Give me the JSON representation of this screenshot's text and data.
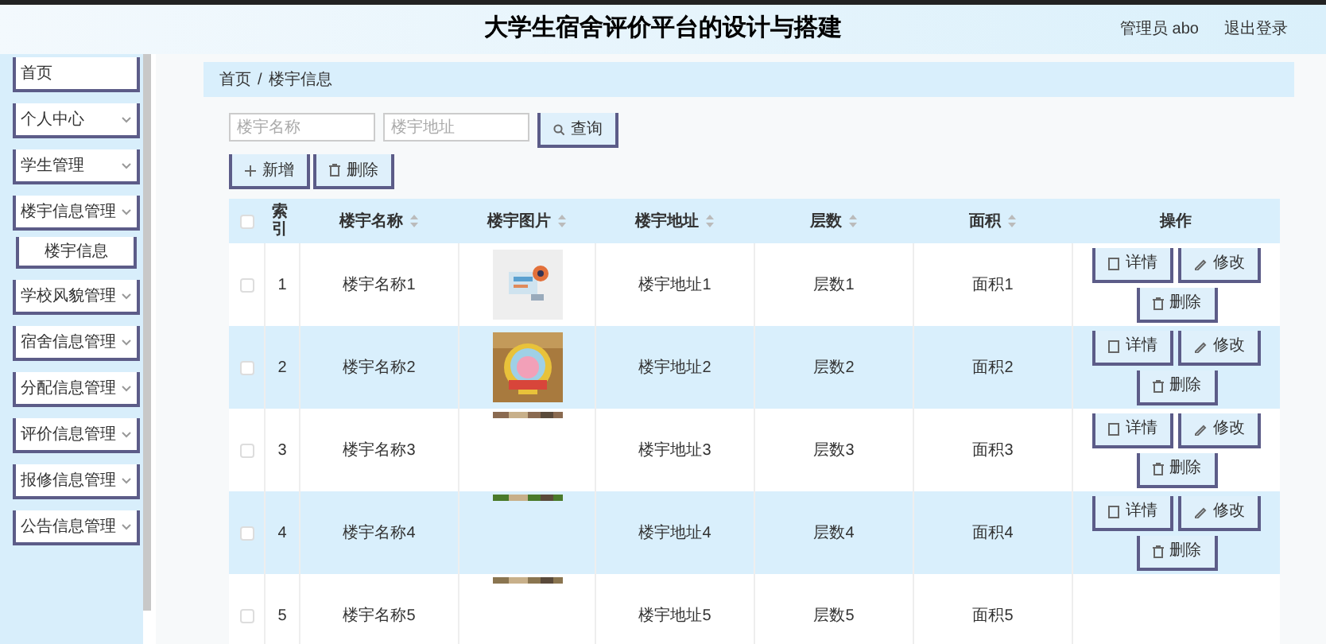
{
  "header": {
    "title": "大学生宿舍评价平台的设计与搭建",
    "user": "管理员 abo",
    "logout": "退出登录"
  },
  "sidebar": {
    "items": [
      {
        "label": "首页",
        "expandable": false
      },
      {
        "label": "个人中心",
        "expandable": true
      },
      {
        "label": "学生管理",
        "expandable": true
      },
      {
        "label": "楼宇信息管理",
        "expandable": true,
        "children": [
          {
            "label": "楼宇信息",
            "expandable": false
          }
        ]
      },
      {
        "label": "学校风貌管理",
        "expandable": true
      },
      {
        "label": "宿舍信息管理",
        "expandable": true
      },
      {
        "label": "分配信息管理",
        "expandable": true
      },
      {
        "label": "评价信息管理",
        "expandable": true
      },
      {
        "label": "报修信息管理",
        "expandable": true
      },
      {
        "label": "公告信息管理",
        "expandable": true
      }
    ]
  },
  "breadcrumb": [
    "首页",
    "/",
    "楼宇信息"
  ],
  "search": {
    "fields": [
      {
        "placeholder": "楼宇名称"
      },
      {
        "placeholder": "楼宇地址"
      }
    ],
    "button": "查询"
  },
  "actions": {
    "add": "新增",
    "delete": "删除"
  },
  "table": {
    "select_all": {
      "checked": false
    },
    "columns": [
      {
        "label": "索引",
        "sortable": false
      },
      {
        "label": "楼宇名称",
        "sortable": true
      },
      {
        "label": "楼宇图片",
        "sortable": true
      },
      {
        "label": "楼宇地址",
        "sortable": true
      },
      {
        "label": "层数",
        "sortable": true
      },
      {
        "label": "面积",
        "sortable": true
      },
      {
        "label": "操作",
        "sortable": false
      }
    ],
    "rows": [
      {
        "checked": false,
        "cells": [
          "1",
          "楼宇名称1",
          "",
          "楼宇地址1",
          "层数1",
          "面积1"
        ],
        "buttons": [
          "详情",
          "修改",
          "删除"
        ]
      },
      {
        "checked": false,
        "cells": [
          "2",
          "楼宇名称2",
          "",
          "楼宇地址2",
          "层数2",
          "面积2"
        ],
        "buttons": [
          "详情",
          "修改",
          "删除"
        ]
      },
      {
        "checked": false,
        "cells": [
          "3",
          "楼宇名称3",
          "",
          "楼宇地址3",
          "层数3",
          "面积3"
        ],
        "buttons": [
          "详情",
          "修改",
          "删除"
        ]
      },
      {
        "checked": false,
        "cells": [
          "4",
          "楼宇名称4",
          "",
          "楼宇地址4",
          "层数4",
          "面积4"
        ],
        "buttons": [
          "详情",
          "修改",
          "删除"
        ]
      },
      {
        "checked": false,
        "cells": [
          "5",
          "楼宇名称5",
          "",
          "楼宇地址5",
          "层数5",
          "面积5"
        ]
      }
    ]
  }
}
